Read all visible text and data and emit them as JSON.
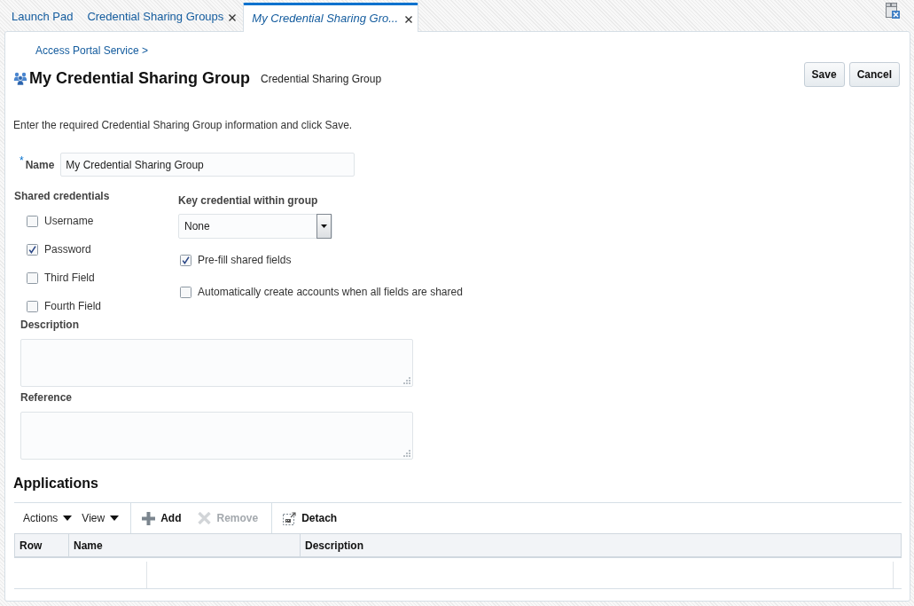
{
  "tabs": [
    {
      "label": "Launch Pad",
      "selected": false,
      "closable": false
    },
    {
      "label": "Credential Sharing Groups",
      "selected": false,
      "closable": true
    },
    {
      "label": "My Credential Sharing Gro...",
      "selected": true,
      "closable": true
    }
  ],
  "breadcrumb": "Access Portal Service >",
  "header": {
    "title": "My Credential Sharing Group",
    "subtitle": "Credential Sharing Group",
    "buttons": [
      "Save",
      "Cancel"
    ]
  },
  "instructions": "Enter the required Credential Sharing Group information and click Save.",
  "name_field": {
    "required_mark": "*",
    "label": "Name",
    "value": "My Credential Sharing Group"
  },
  "shared_credentials": {
    "label": "Shared credentials",
    "items": [
      {
        "label": "Username",
        "checked": false
      },
      {
        "label": "Password",
        "checked": true
      },
      {
        "label": "Third Field",
        "checked": false
      },
      {
        "label": "Fourth Field",
        "checked": false
      }
    ]
  },
  "key_credential": {
    "label": "Key credential within group",
    "value": "None"
  },
  "group_options": [
    {
      "label": "Pre-fill shared fields",
      "checked": true
    },
    {
      "label": "Automatically create accounts when all fields are shared",
      "checked": false
    }
  ],
  "description": {
    "label": "Description"
  },
  "reference": {
    "label": "Reference"
  },
  "applications": {
    "title": "Applications",
    "toolbar_groups": [
      {
        "items": [
          {
            "kind": "menu",
            "label": "Actions",
            "disabled": false
          },
          {
            "kind": "menu",
            "label": "View",
            "disabled": false
          }
        ]
      },
      {
        "items": [
          {
            "kind": "add",
            "label": "Add",
            "disabled": false
          },
          {
            "kind": "remove",
            "label": "Remove",
            "disabled": true
          }
        ]
      },
      {
        "items": [
          {
            "kind": "detach",
            "label": "Detach",
            "disabled": false
          }
        ]
      }
    ],
    "table": {
      "columns": [
        "Row",
        "Name",
        "Description"
      ]
    }
  }
}
